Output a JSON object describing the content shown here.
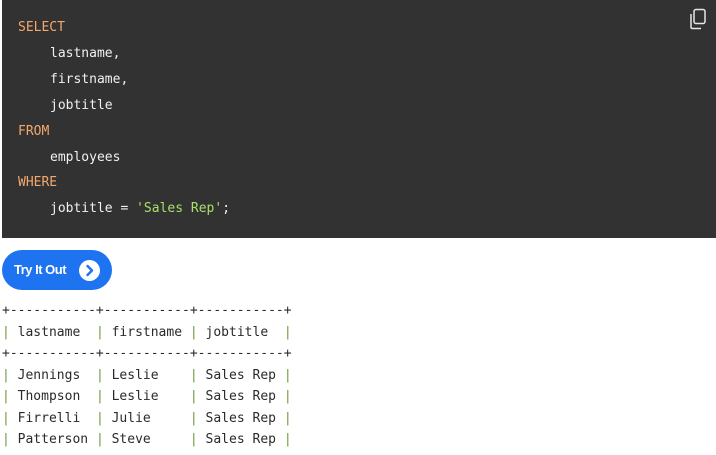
{
  "code": {
    "lines": [
      {
        "text": "SELECT",
        "kind": "keyword"
      },
      {
        "text": "lastname,",
        "kind": "plain"
      },
      {
        "text": "firstname,",
        "kind": "plain"
      },
      {
        "text": "jobtitle",
        "kind": "plain"
      },
      {
        "text": "FROM",
        "kind": "keyword"
      },
      {
        "text": "employees",
        "kind": "plain"
      },
      {
        "text": "WHERE",
        "kind": "keyword"
      },
      {
        "prefix": "jobtitle = ",
        "string": "'Sales Rep'",
        "suffix": ";",
        "kind": "mixed"
      }
    ],
    "copy_icon": "copy-icon"
  },
  "try_button": {
    "label": "Try It Out",
    "icon": "chevron-right-icon"
  },
  "result": {
    "border_line": "+-----------+-----------+-----------+",
    "headers": [
      "lastname",
      "firstname",
      "jobtitle"
    ],
    "rows": [
      [
        "Jennings",
        "Leslie",
        "Sales Rep"
      ],
      [
        "Thompson",
        "Leslie",
        "Sales Rep"
      ],
      [
        "Firrelli",
        "Julie",
        "Sales Rep"
      ],
      [
        "Patterson",
        "Steve",
        "Sales Rep"
      ]
    ]
  },
  "colors": {
    "code_background": "#323232",
    "keyword": "#f2a86c",
    "string": "#a8e06a",
    "button": "#1e73f0",
    "separator": "#6f9a3a"
  }
}
